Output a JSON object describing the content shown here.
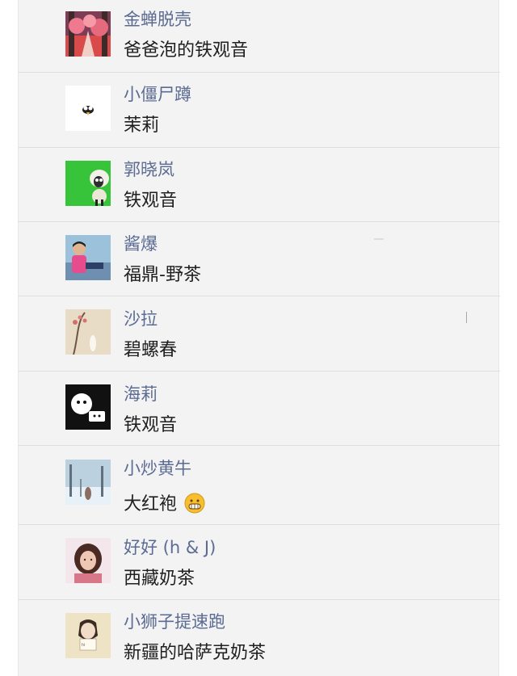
{
  "chats": [
    {
      "name": "金蝉脱壳",
      "message": "爸爸泡的铁观音",
      "avatar_icon": "forest-path-avatar-icon"
    },
    {
      "name": "小僵尸蹲",
      "message": "茉莉",
      "avatar_icon": "cartoon-bird-avatar-icon"
    },
    {
      "name": "郭晓岚",
      "message": "铁观音",
      "avatar_icon": "sheep-avatar-icon"
    },
    {
      "name": "酱爆",
      "message": "福鼎-野茶",
      "avatar_icon": "person-photo-avatar-icon"
    },
    {
      "name": "沙拉",
      "message": "碧螺春",
      "avatar_icon": "flower-illustration-avatar-icon"
    },
    {
      "name": "海莉",
      "message": "铁观音",
      "avatar_icon": "cartoon-faces-avatar-icon"
    },
    {
      "name": "小炒黄牛",
      "message": "大红袍",
      "avatar_icon": "snow-forest-avatar-icon",
      "emoji": "grinning-emoji-icon"
    },
    {
      "name": "好好 (h & J)",
      "message": "西藏奶茶",
      "avatar_icon": "girl-photo-avatar-icon"
    },
    {
      "name": "小狮子提速跑",
      "message": "新疆的哈萨克奶茶",
      "avatar_icon": "drawing-avatar-icon"
    }
  ],
  "colors": {
    "name_text": "#5b6b93",
    "message_text": "#1f1f1f",
    "panel_background": "#f3f3f3",
    "divider": "#dedede"
  }
}
